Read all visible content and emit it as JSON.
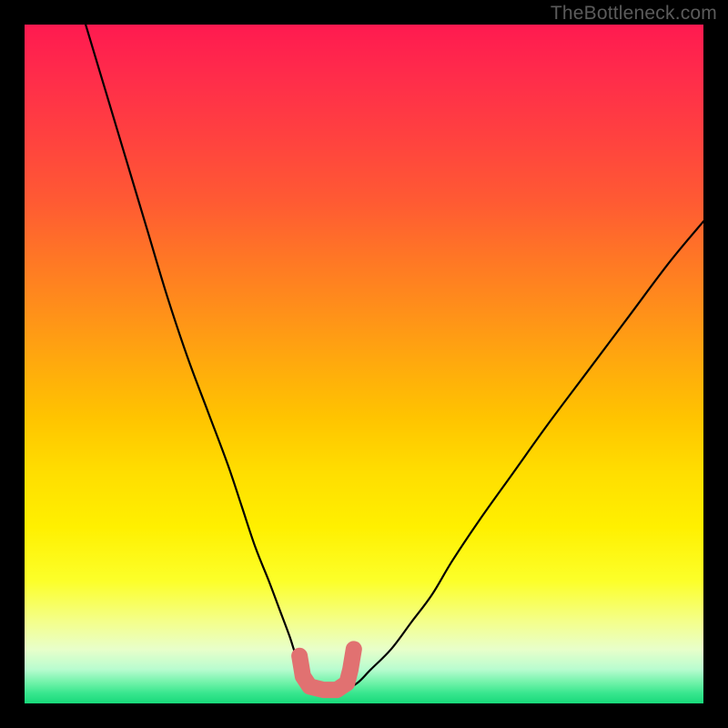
{
  "watermark": {
    "text": "TheBottleneck.com"
  },
  "chart_data": {
    "type": "line",
    "title": "",
    "xlabel": "",
    "ylabel": "",
    "xlim": [
      0,
      100
    ],
    "ylim": [
      0,
      100
    ],
    "grid": false,
    "legend": false,
    "annotations": [],
    "series": [
      {
        "name": "bottleneck-curve",
        "color": "#000000",
        "x": [
          9,
          12,
          15,
          18,
          21,
          24,
          27,
          30,
          32,
          34,
          36,
          37.5,
          39,
          40,
          41,
          42,
          43.5,
          45,
          47,
          49,
          51,
          54,
          57,
          60,
          63,
          67,
          72,
          77,
          83,
          89,
          95,
          100
        ],
        "y": [
          100,
          90,
          80,
          70,
          60,
          51,
          43,
          35,
          29,
          23,
          18,
          14,
          10,
          7,
          5,
          3,
          2,
          2,
          2,
          3,
          5,
          8,
          12,
          16,
          21,
          27,
          34,
          41,
          49,
          57,
          65,
          71
        ]
      },
      {
        "name": "optimal-marker",
        "color": "#e17171",
        "shape": "u-bracket",
        "x": [
          40.5,
          41,
          42,
          44,
          46,
          47.5,
          48,
          48.5
        ],
        "y": [
          7,
          4,
          2.5,
          2,
          2,
          3,
          5,
          8
        ]
      }
    ],
    "background_gradient": {
      "direction": "vertical",
      "stops": [
        {
          "pos": 0.0,
          "color": "#ff1a50"
        },
        {
          "pos": 0.5,
          "color": "#ffaa0d"
        },
        {
          "pos": 0.74,
          "color": "#fff000"
        },
        {
          "pos": 0.95,
          "color": "#b8fccf"
        },
        {
          "pos": 1.0,
          "color": "#18d97a"
        }
      ]
    }
  }
}
